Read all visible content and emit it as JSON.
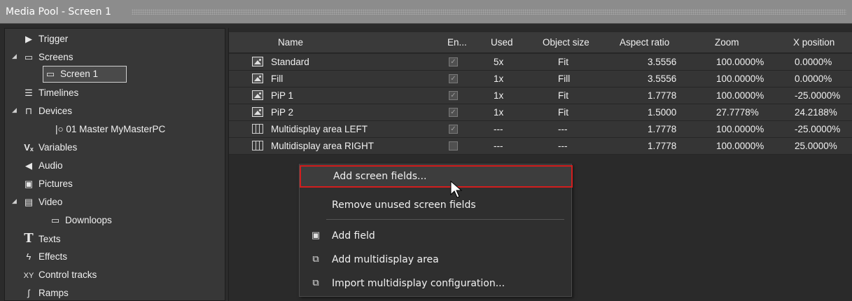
{
  "window": {
    "title": "Media Pool - Screen 1"
  },
  "tree": {
    "items": [
      {
        "label": "Trigger",
        "icon": "trigger-icon"
      },
      {
        "label": "Screens",
        "icon": "screens-icon"
      },
      {
        "label": "Screen 1",
        "icon": "screen-icon"
      },
      {
        "label": "Timelines",
        "icon": "timelines-icon"
      },
      {
        "label": "Devices",
        "icon": "devices-icon"
      },
      {
        "label": "|○ 01 Master MyMasterPC",
        "icon": ""
      },
      {
        "label": "Variables",
        "icon": "variables-icon"
      },
      {
        "label": "Audio",
        "icon": "audio-icon"
      },
      {
        "label": "Pictures",
        "icon": "pictures-icon"
      },
      {
        "label": "Video",
        "icon": "video-icon"
      },
      {
        "label": "Downloops",
        "icon": "folder-icon"
      },
      {
        "label": "Texts",
        "icon": "texts-icon"
      },
      {
        "label": "Effects",
        "icon": "effects-icon"
      },
      {
        "label": "Control tracks",
        "icon": "control-tracks-icon"
      },
      {
        "label": "Ramps",
        "icon": "ramps-icon"
      }
    ]
  },
  "table": {
    "columns": [
      "Name",
      "En...",
      "Used",
      "Object size",
      "Aspect ratio",
      "Zoom",
      "X position"
    ],
    "rows": [
      {
        "name": "Standard",
        "used": "5x",
        "size": "Fit",
        "aspect": "3.5556",
        "zoom": "100.0000%",
        "x": "0.0000%",
        "checked": true
      },
      {
        "name": "Fill",
        "used": "1x",
        "size": "Fill",
        "aspect": "3.5556",
        "zoom": "100.0000%",
        "x": "0.0000%",
        "checked": true
      },
      {
        "name": "PiP 1",
        "used": "1x",
        "size": "Fit",
        "aspect": "1.7778",
        "zoom": "100.0000%",
        "x": "-25.0000%",
        "checked": true
      },
      {
        "name": "PiP 2",
        "used": "1x",
        "size": "Fit",
        "aspect": "1.5000",
        "zoom": "27.7778%",
        "x": "24.2188%",
        "checked": true
      },
      {
        "name": "Multidisplay area LEFT",
        "used": "---",
        "size": "---",
        "aspect": "1.7778",
        "zoom": "100.0000%",
        "x": "-25.0000%",
        "checked": true
      },
      {
        "name": "Multidisplay area RIGHT",
        "used": "---",
        "size": "---",
        "aspect": "1.7778",
        "zoom": "100.0000%",
        "x": "25.0000%",
        "checked": false
      }
    ]
  },
  "context_menu": {
    "items": [
      {
        "label": "Add screen fields..."
      },
      {
        "label": "Remove unused screen fields"
      },
      {
        "label": "Add field"
      },
      {
        "label": "Add multidisplay area"
      },
      {
        "label": "Import multidisplay configuration..."
      }
    ]
  },
  "colors": {
    "highlight_border": "#d21e1e",
    "background": "#2b2b2b",
    "titlebar": "#8c8c8c"
  }
}
